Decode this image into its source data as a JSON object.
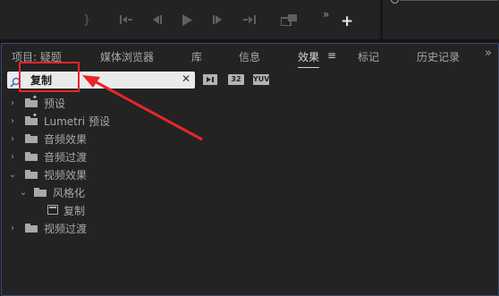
{
  "transport": {
    "buttons": [
      "}",
      "{←",
      "◀|",
      "▶",
      "|▶",
      "→}",
      "export-frame"
    ],
    "more": "»",
    "add": "+"
  },
  "panel": {
    "tabs": [
      {
        "label": "项目: 疑题",
        "active": false
      },
      {
        "label": "媒体浏览器",
        "active": false
      },
      {
        "label": "库",
        "active": false
      },
      {
        "label": "信息",
        "active": false
      },
      {
        "label": "效果",
        "active": true
      },
      {
        "label": "标记",
        "active": false
      },
      {
        "label": "历史记录",
        "active": false
      }
    ],
    "tab_menu": "≡",
    "tab_more": "»"
  },
  "search": {
    "value": "复制",
    "clear": "✕"
  },
  "filter_buttons": [
    "32",
    "YUV"
  ],
  "tree": [
    {
      "label": "预设",
      "level": 0,
      "expanded": false,
      "icon": "preset-folder-icon"
    },
    {
      "label": "Lumetri 预设",
      "level": 0,
      "expanded": false,
      "icon": "preset-folder-icon"
    },
    {
      "label": "音频效果",
      "level": 0,
      "expanded": false,
      "icon": "folder-icon"
    },
    {
      "label": "音频过渡",
      "level": 0,
      "expanded": false,
      "icon": "folder-icon"
    },
    {
      "label": "视频效果",
      "level": 0,
      "expanded": true,
      "icon": "folder-icon"
    },
    {
      "label": "风格化",
      "level": 1,
      "expanded": true,
      "icon": "folder-icon"
    },
    {
      "label": "复制",
      "level": 2,
      "expanded": null,
      "icon": "effect-icon"
    },
    {
      "label": "视频过渡",
      "level": 0,
      "expanded": false,
      "icon": "folder-icon"
    }
  ],
  "colors": {
    "annotation": "#e8262a",
    "panel_border": "#3a4b6e",
    "background": "#232323"
  }
}
